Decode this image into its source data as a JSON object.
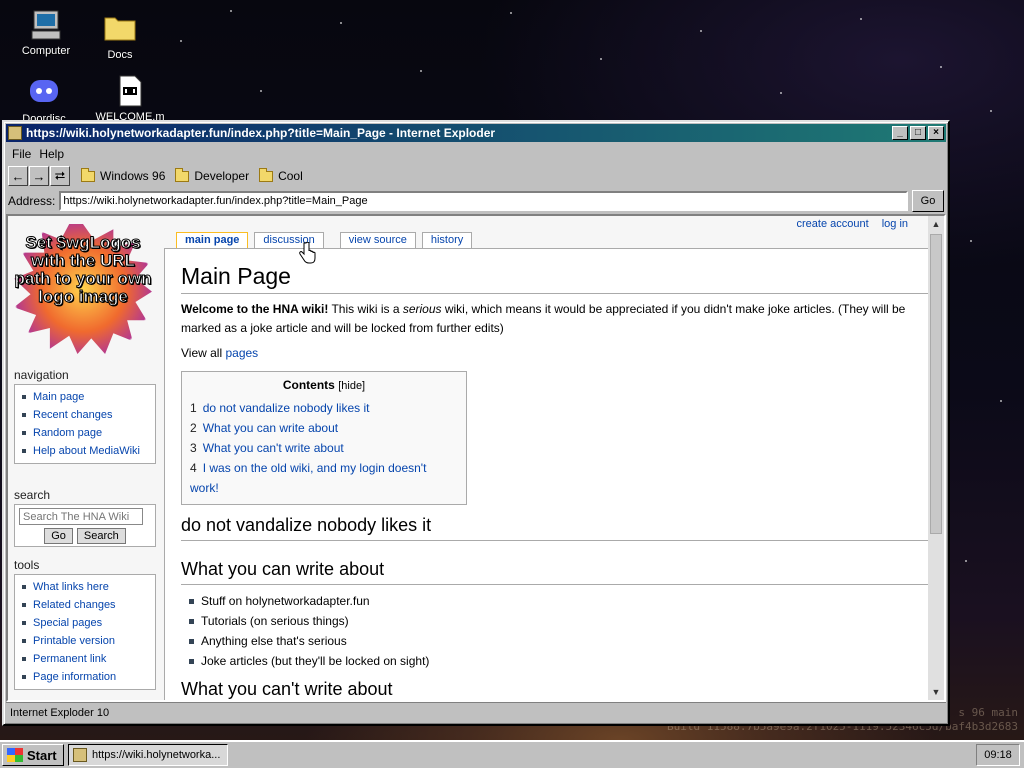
{
  "desktop": {
    "icons": [
      {
        "label": "Computer"
      },
      {
        "label": "Docs"
      },
      {
        "label": "Doordisc"
      },
      {
        "label": "WELCOME.m"
      }
    ],
    "build_line1": "s 96 main",
    "build_line2": "Build 11588.7b5a9e9a.2f1025-1119.52346c5d/baf4b3d2683"
  },
  "window": {
    "title": "https://wiki.holynetworkadapter.fun/index.php?title=Main_Page - Internet Exploder",
    "menu": [
      "File",
      "Help"
    ],
    "nav_buttons": {
      "back": "←",
      "forward": "→",
      "refresh": "⮂"
    },
    "favorites": [
      "Windows 96",
      "Developer",
      "Cool"
    ],
    "address_label": "Address:",
    "address_value": "https://wiki.holynetworkadapter.fun/index.php?title=Main_Page",
    "go_label": "Go",
    "status": "Internet Exploder 10"
  },
  "wiki": {
    "personal": [
      "create account",
      "log in"
    ],
    "logo_text": "Set $wgLogos with the URL path to your own logo image",
    "tabs": [
      "main page",
      "discussion",
      "view source",
      "history"
    ],
    "nav_title": "navigation",
    "nav_items": [
      "Main page",
      "Recent changes",
      "Random page",
      "Help about MediaWiki"
    ],
    "search_title": "search",
    "search_placeholder": "Search The HNA Wiki",
    "search_go": "Go",
    "search_btn": "Search",
    "tools_title": "tools",
    "tools_items": [
      "What links here",
      "Related changes",
      "Special pages",
      "Printable version",
      "Permanent link",
      "Page information"
    ],
    "page_title": "Main Page",
    "intro_bold": "Welcome to the HNA wiki!",
    "intro_rest1": " This wiki is a ",
    "intro_em": "serious",
    "intro_rest2": " wiki, which means it would be appreciated if you didn't make joke articles. (They will be marked as a joke article and will be locked from further edits)",
    "view_all_prefix": "View all ",
    "view_all_link": "pages",
    "toc_title": "Contents",
    "toc_hide": "[hide]",
    "toc": [
      {
        "num": "1",
        "text": "do not vandalize nobody likes it"
      },
      {
        "num": "2",
        "text": "What you can write about"
      },
      {
        "num": "3",
        "text": "What you can't write about"
      },
      {
        "num": "4",
        "text": "I was on the old wiki, and my login doesn't work!"
      }
    ],
    "h2_1": "do not vandalize nobody likes it",
    "h2_2": "What you can write about",
    "can_list": [
      "Stuff on holynetworkadapter.fun",
      "Tutorials (on serious things)",
      "Anything else that's serious",
      "Joke articles (but they'll be locked on sight)"
    ],
    "h2_3": "What you can't write about"
  },
  "taskbar": {
    "start": "Start",
    "task": "https://wiki.holynetworka...",
    "clock": "09:18"
  }
}
